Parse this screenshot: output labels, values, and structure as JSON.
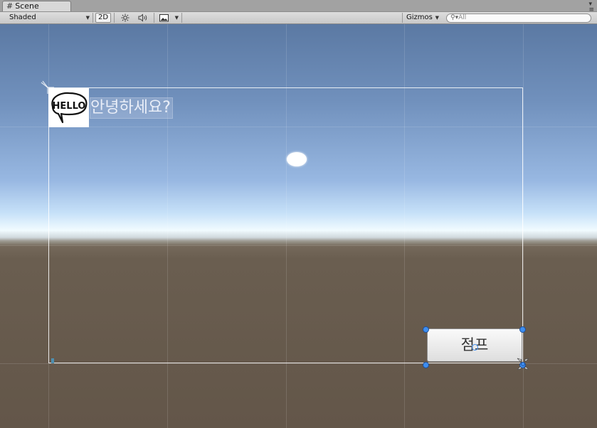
{
  "window": {
    "tab_label": "Scene",
    "tab_icon": "grid-hash-icon",
    "menu_icon": "window-menu-icon"
  },
  "toolbar": {
    "draw_mode": "Shaded",
    "mode_2d": "2D",
    "lighting_icon": "sun-icon",
    "audio_icon": "speaker-icon",
    "effects_icon": "image-icon",
    "gizmos": "Gizmos",
    "search_placeholder": "All"
  },
  "scene": {
    "greeting_text": "안녕하세요?",
    "hello_image_text": "HELLO",
    "button_label": "점프"
  },
  "colors": {
    "sky_top": "#5b79a3",
    "horizon": "#f1fbff",
    "ground": "#635649",
    "handle_blue": "#3e8ef0"
  }
}
